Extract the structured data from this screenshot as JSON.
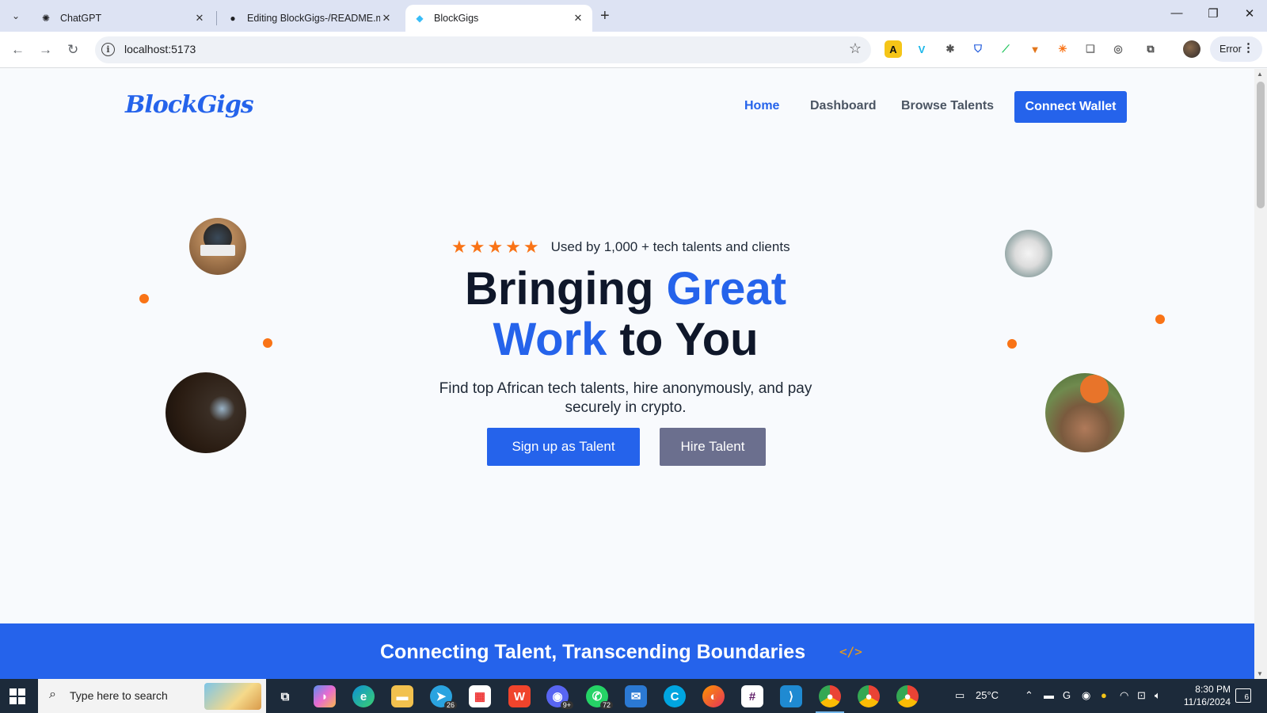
{
  "browser": {
    "tabs": [
      {
        "title": "ChatGPT",
        "active": false
      },
      {
        "title": "Editing BlockGigs-/README.md",
        "active": false
      },
      {
        "title": "BlockGigs",
        "active": true
      }
    ],
    "url": "localhost:5173",
    "profile_status": "Error"
  },
  "site": {
    "logo": "BlockGigs",
    "nav": {
      "home": "Home",
      "dashboard": "Dashboard",
      "browse": "Browse Talents",
      "connect": "Connect Wallet"
    },
    "hero": {
      "stars": "★★★★★",
      "rating_text": "Used by 1,000 + tech talents and clients",
      "title_part1": "Bringing ",
      "title_highlight1": "Great",
      "title_highlight2": "Work",
      "title_part2": " to You",
      "subtitle": "Find top African tech talents, hire anonymously, and pay securely in crypto.",
      "cta_primary": "Sign up as Talent",
      "cta_secondary": "Hire Talent"
    },
    "banner": {
      "text": "Connecting Talent, Transcending Boundaries",
      "icon": "</>"
    }
  },
  "taskbar": {
    "search_placeholder": "Type here to search",
    "telegram_badge": "26",
    "discord_badge": "9+",
    "whatsapp_badge": "72",
    "weather": "25°C",
    "time": "8:30 PM",
    "date": "11/16/2024",
    "notifications": "6"
  },
  "colors": {
    "brand": "#2563eb",
    "accent": "#f97316",
    "secondary_button": "#6b6f8e"
  }
}
